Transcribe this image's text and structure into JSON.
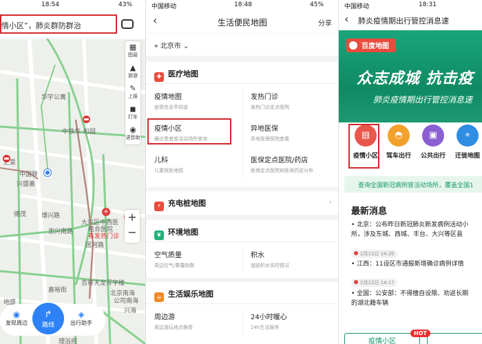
{
  "panel1": {
    "status": {
      "time": "18:54",
      "battery": "43%"
    },
    "search": {
      "text": "情小区”，肺炎群防群治"
    },
    "tools": [
      {
        "label": "图层",
        "icon": "layers-icon"
      },
      {
        "label": "旅游",
        "icon": "travel-icon"
      },
      {
        "label": "上报",
        "icon": "report-icon"
      },
      {
        "label": "打车",
        "icon": "taxi-icon"
      },
      {
        "label": "语音助",
        "icon": "voice-assistant-icon"
      }
    ],
    "map_labels": [
      "华宇公寓",
      "中铁华",
      "·和园",
      "汇景",
      "中国铁",
      "兴盛嘉",
      "德茂",
      "忠兴南路",
      "博兴路",
      "大兴区中西医",
      "结合医院",
      "有发热门诊",
      "嘉裕街",
      "吉祥天龙写字楼",
      "北京南海",
      "公司南海",
      "兴海",
      "理浴府",
      "地盛",
      "团河路"
    ],
    "zoom": {
      "plus": "+",
      "minus": "−"
    },
    "bottom": {
      "discover": "发现周边",
      "route": "路线",
      "assistant": "出行助手"
    }
  },
  "panel2": {
    "status": {
      "carrier": "中国移动",
      "time": "18:48",
      "battery": "45%"
    },
    "title": "生活便民地图",
    "share": "分享",
    "city": "北京市",
    "sections": [
      {
        "title": "医疗地图",
        "color": "#e84c3d",
        "items": [
          {
            "title": "疫情地图",
            "sub": "疫情信息早知道"
          },
          {
            "title": "发热门诊",
            "sub": "发热门诊定点医院"
          },
          {
            "title": "疫情小区",
            "sub": "确诊患者曾活动场所查询"
          },
          {
            "title": "异地医保",
            "sub": "异地医保医院查看"
          },
          {
            "title": "儿科",
            "sub": "儿童就医地图"
          },
          {
            "title": "医保定点医院/药店",
            "sub": "医保定点医院和医保药店分布"
          }
        ]
      },
      {
        "title": "充电桩地图",
        "color": "#e84c3d"
      },
      {
        "title": "环境地图",
        "color": "#23b07a",
        "items": [
          {
            "title": "空气质量",
            "sub": "周边空气/雾霾指数"
          },
          {
            "title": "积水",
            "sub": "道路积水实时情况"
          }
        ]
      },
      {
        "title": "生活娱乐地图",
        "color": "#f08a24",
        "items": [
          {
            "title": "周边游",
            "sub": "周边游玩地点推荐"
          },
          {
            "title": "24小时暖心",
            "sub": "24h生活服务"
          }
        ]
      }
    ]
  },
  "panel3": {
    "status": {
      "carrier": "中国移动",
      "time": "18:31"
    },
    "title": "肺炎疫情期出行管控消息速",
    "logo": "百度地图",
    "banner_main": "众志成城 抗击疫",
    "banner_sub": "肺炎疫情期出行管控消息速",
    "buttons": [
      {
        "label": "疫情小区",
        "color": "#e8584a",
        "icon": "document-icon"
      },
      {
        "label": "驾车出行",
        "color": "#f2a12c",
        "icon": "car-icon"
      },
      {
        "label": "公共出行",
        "color": "#8a5fd1",
        "icon": "bus-icon"
      },
      {
        "label": "迁徙地图",
        "color": "#2f8de4",
        "icon": "map-icon"
      }
    ],
    "notice": "查询全国新冠病例曾活动场所，覆盖全国1",
    "news_title": "最新消息",
    "news": [
      {
        "text": "• 北京：公布昨日新冠肺炎新发病例活动小",
        "text2": "所，涉及东城、西城、丰台、大兴等区县"
      },
      {
        "date": "2月12日 14:20",
        "text": "• 江西：11设区市通报新增确诊病例详情"
      },
      {
        "date": "2月12日 14:17",
        "text": "• 全国：公安部：不得擅自设限、劝返长期",
        "text2": "的湖北籍车辆"
      }
    ],
    "bottom_button": "疫情小区",
    "hot": "HOT"
  }
}
